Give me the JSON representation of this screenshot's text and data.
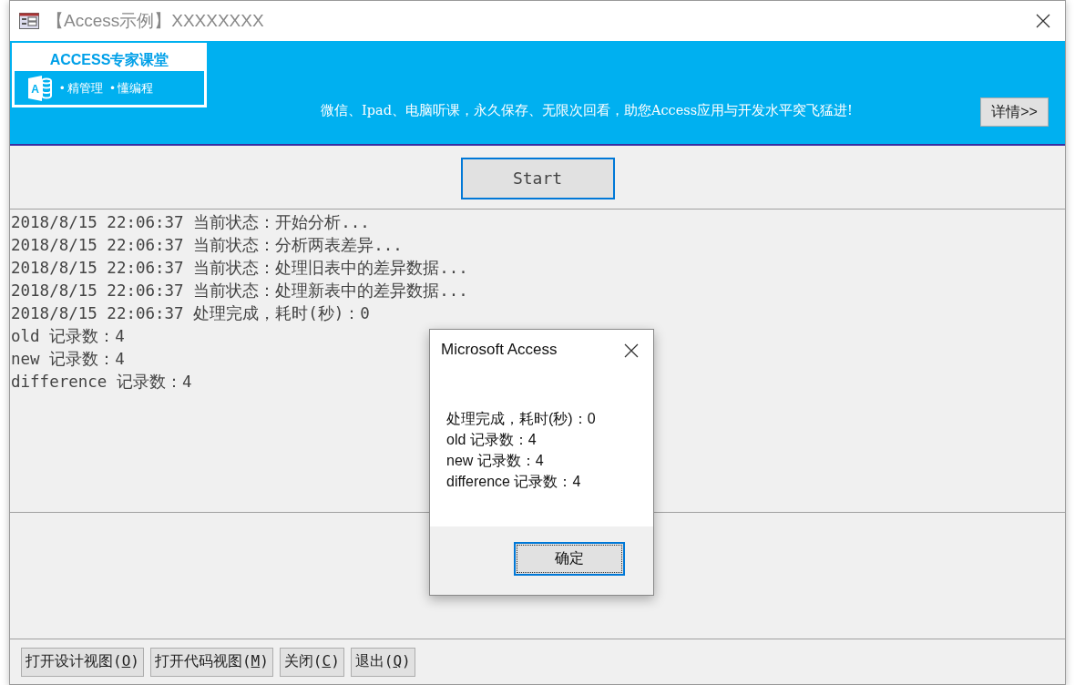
{
  "window": {
    "title": "【Access示例】XXXXXXXX"
  },
  "banner": {
    "logo_title": "ACCESS专家课堂",
    "logo_letter": "A",
    "logo_tags": [
      "• 精管理",
      "• 懂编程"
    ],
    "slogan": "微信、Ipad、电脑听课，永久保存、无限次回看，助您Access应用与开发水平突飞猛进!",
    "details_button": "详情>>"
  },
  "start_button": "Start",
  "log_lines": [
    "2018/8/15 22:06:37 当前状态：开始分析...",
    "2018/8/15 22:06:37 当前状态：分析两表差异...",
    "2018/8/15 22:06:37 当前状态：处理旧表中的差异数据...",
    "2018/8/15 22:06:37 当前状态：处理新表中的差异数据...",
    "2018/8/15 22:06:37 处理完成，耗时(秒)：0",
    "old 记录数：4",
    "new 记录数：4",
    "difference 记录数：4"
  ],
  "footer_buttons": [
    {
      "prefix": "打开设计视图(",
      "key": "O",
      "suffix": ")"
    },
    {
      "prefix": "打开代码视图(",
      "key": "M",
      "suffix": ")"
    },
    {
      "prefix": "关闭(",
      "key": "C",
      "suffix": ")"
    },
    {
      "prefix": "退出(",
      "key": "Q",
      "suffix": ")"
    }
  ],
  "dialog": {
    "title": "Microsoft Access",
    "message_lines": [
      "处理完成，耗时(秒)：0",
      "old 记录数：4",
      "new 记录数：4",
      "difference 记录数：4"
    ],
    "ok_button": "确定"
  }
}
